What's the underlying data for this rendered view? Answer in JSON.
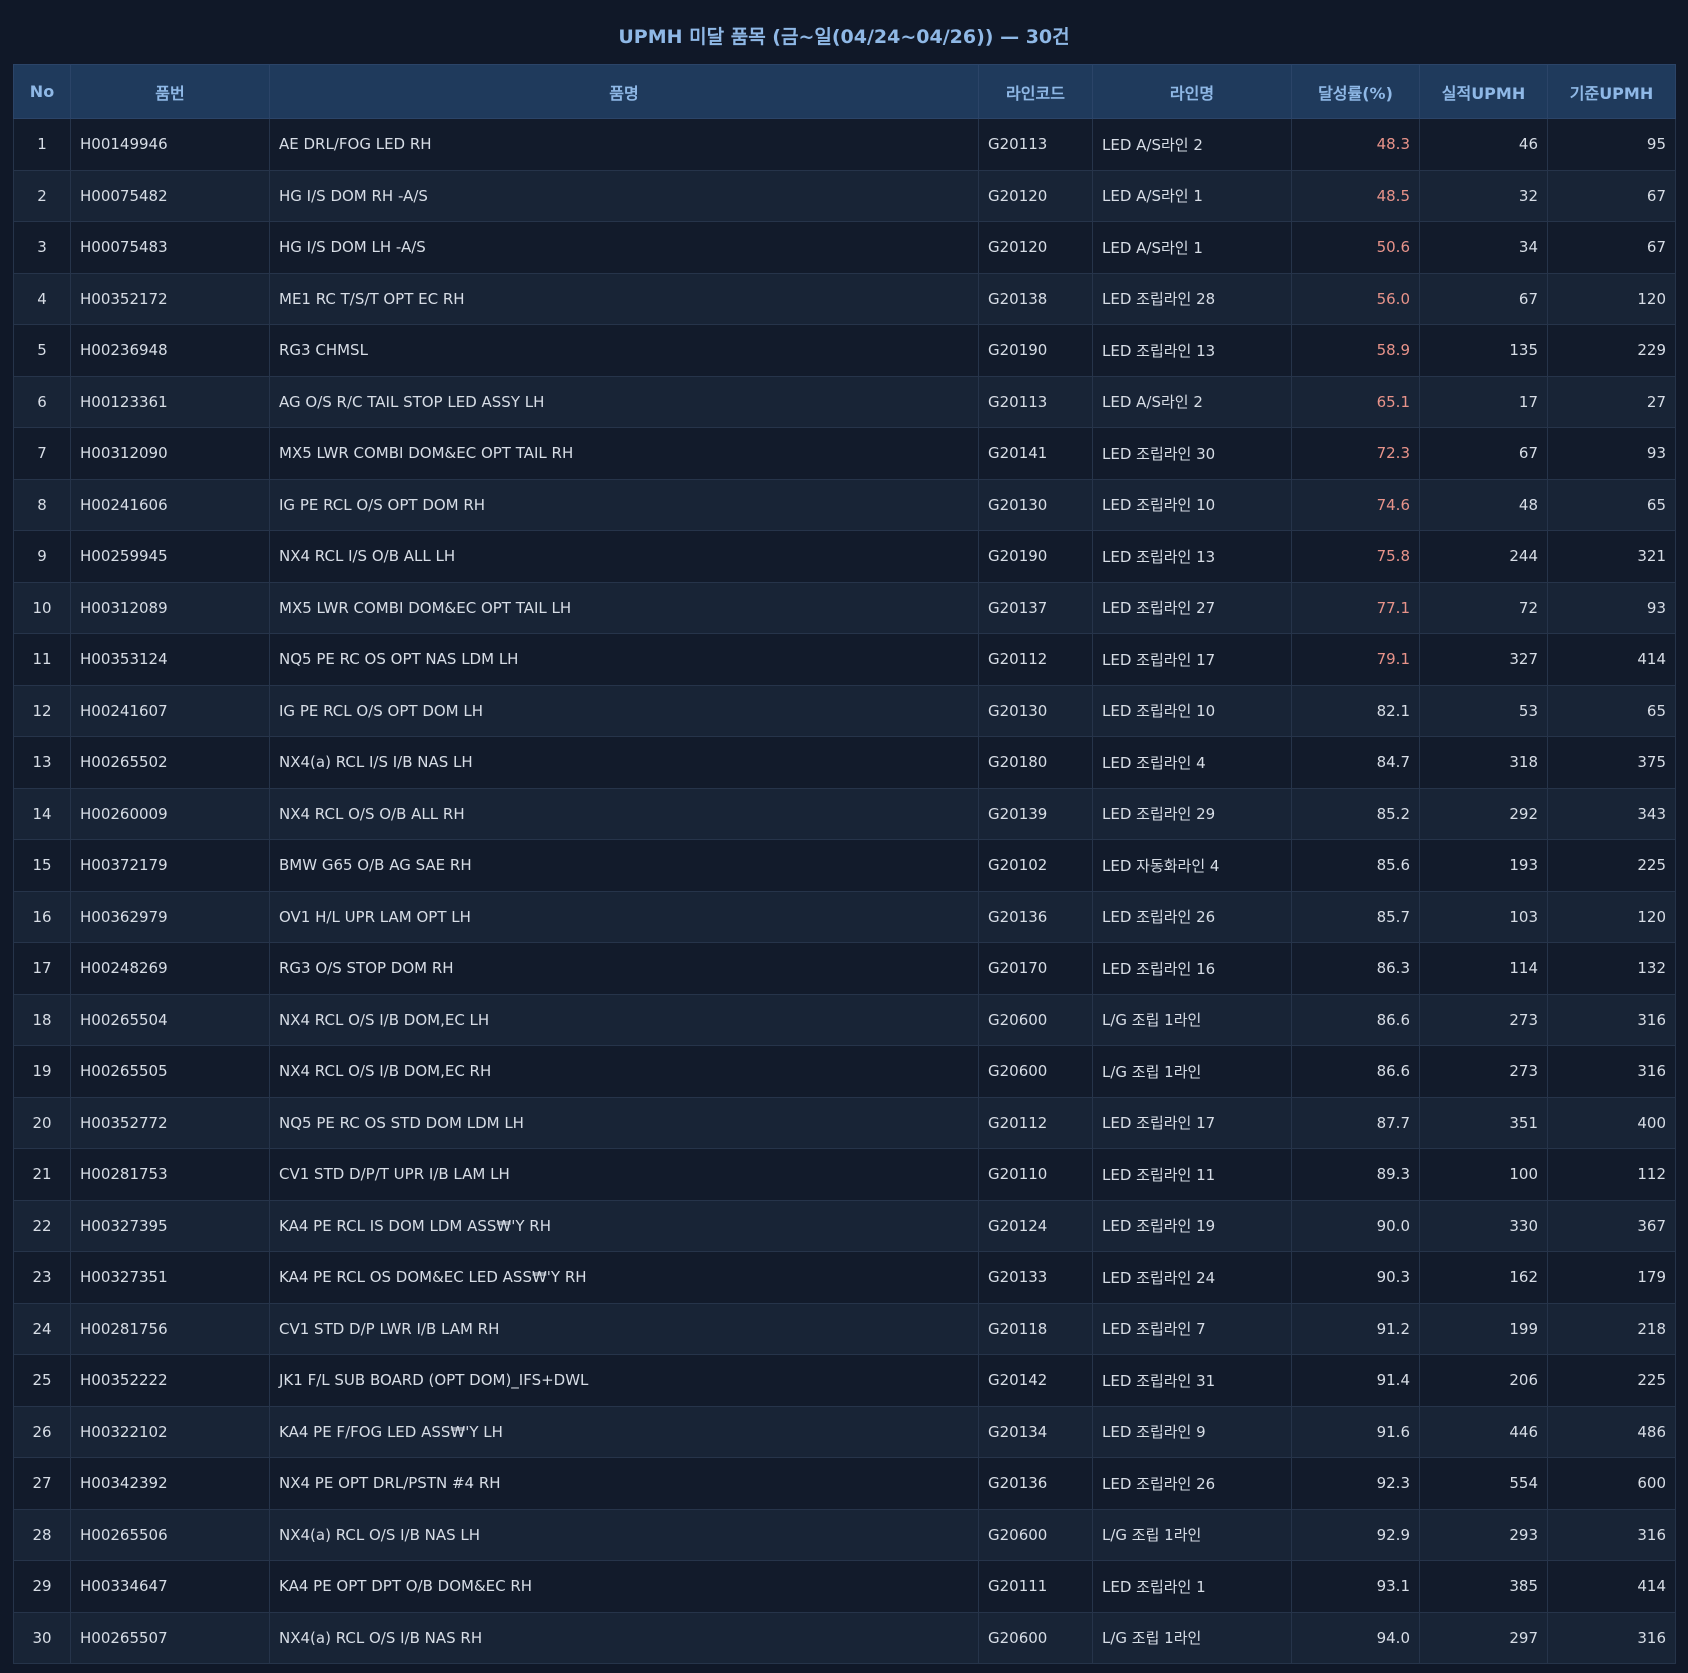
{
  "title": "UPMH 미달 품목 (금~일(04/24~04/26)) — 30건",
  "colors": {
    "background": "#101828",
    "header_bg": "#1f3a5c",
    "header_text": "#8fb8e6",
    "low_rate": "#e8938a",
    "text": "#d7dde6"
  },
  "columns": [
    "No",
    "품번",
    "품명",
    "라인코드",
    "라인명",
    "달성률(%)",
    "실적UPMH",
    "기준UPMH"
  ],
  "rows": [
    {
      "no": "1",
      "part": "H00149946",
      "name": "AE DRL/FOG LED RH",
      "code": "G20113",
      "line": "LED A/S라인 2",
      "rate": "48.3",
      "actual": "46",
      "std": "95",
      "low": true
    },
    {
      "no": "2",
      "part": "H00075482",
      "name": "HG I/S DOM RH -A/S",
      "code": "G20120",
      "line": "LED A/S라인 1",
      "rate": "48.5",
      "actual": "32",
      "std": "67",
      "low": true
    },
    {
      "no": "3",
      "part": "H00075483",
      "name": "HG I/S DOM LH -A/S",
      "code": "G20120",
      "line": "LED A/S라인 1",
      "rate": "50.6",
      "actual": "34",
      "std": "67",
      "low": true
    },
    {
      "no": "4",
      "part": "H00352172",
      "name": "ME1 RC T/S/T OPT EC RH",
      "code": "G20138",
      "line": "LED 조립라인 28",
      "rate": "56.0",
      "actual": "67",
      "std": "120",
      "low": true
    },
    {
      "no": "5",
      "part": "H00236948",
      "name": "RG3 CHMSL",
      "code": "G20190",
      "line": "LED 조립라인 13",
      "rate": "58.9",
      "actual": "135",
      "std": "229",
      "low": true
    },
    {
      "no": "6",
      "part": "H00123361",
      "name": "AG O/S R/C TAIL STOP LED ASSY LH",
      "code": "G20113",
      "line": "LED A/S라인 2",
      "rate": "65.1",
      "actual": "17",
      "std": "27",
      "low": true
    },
    {
      "no": "7",
      "part": "H00312090",
      "name": "MX5 LWR COMBI DOM&EC OPT TAIL RH",
      "code": "G20141",
      "line": "LED 조립라인 30",
      "rate": "72.3",
      "actual": "67",
      "std": "93",
      "low": true
    },
    {
      "no": "8",
      "part": "H00241606",
      "name": "IG PE RCL O/S OPT DOM RH",
      "code": "G20130",
      "line": "LED 조립라인 10",
      "rate": "74.6",
      "actual": "48",
      "std": "65",
      "low": true
    },
    {
      "no": "9",
      "part": "H00259945",
      "name": "NX4 RCL I/S O/B ALL LH",
      "code": "G20190",
      "line": "LED 조립라인 13",
      "rate": "75.8",
      "actual": "244",
      "std": "321",
      "low": true
    },
    {
      "no": "10",
      "part": "H00312089",
      "name": "MX5 LWR COMBI DOM&EC OPT TAIL LH",
      "code": "G20137",
      "line": "LED 조립라인 27",
      "rate": "77.1",
      "actual": "72",
      "std": "93",
      "low": true
    },
    {
      "no": "11",
      "part": "H00353124",
      "name": "NQ5 PE RC OS OPT NAS LDM LH",
      "code": "G20112",
      "line": "LED 조립라인 17",
      "rate": "79.1",
      "actual": "327",
      "std": "414",
      "low": true
    },
    {
      "no": "12",
      "part": "H00241607",
      "name": "IG PE RCL O/S OPT DOM LH",
      "code": "G20130",
      "line": "LED 조립라인 10",
      "rate": "82.1",
      "actual": "53",
      "std": "65",
      "low": false
    },
    {
      "no": "13",
      "part": "H00265502",
      "name": "NX4(a) RCL I/S I/B NAS LH",
      "code": "G20180",
      "line": "LED 조립라인 4",
      "rate": "84.7",
      "actual": "318",
      "std": "375",
      "low": false
    },
    {
      "no": "14",
      "part": "H00260009",
      "name": "NX4 RCL O/S O/B ALL RH",
      "code": "G20139",
      "line": "LED 조립라인 29",
      "rate": "85.2",
      "actual": "292",
      "std": "343",
      "low": false
    },
    {
      "no": "15",
      "part": "H00372179",
      "name": "BMW G65 O/B AG SAE RH",
      "code": "G20102",
      "line": "LED 자동화라인 4",
      "rate": "85.6",
      "actual": "193",
      "std": "225",
      "low": false
    },
    {
      "no": "16",
      "part": "H00362979",
      "name": "OV1 H/L UPR LAM OPT LH",
      "code": "G20136",
      "line": "LED 조립라인 26",
      "rate": "85.7",
      "actual": "103",
      "std": "120",
      "low": false
    },
    {
      "no": "17",
      "part": "H00248269",
      "name": "RG3 O/S STOP DOM RH",
      "code": "G20170",
      "line": "LED 조립라인 16",
      "rate": "86.3",
      "actual": "114",
      "std": "132",
      "low": false
    },
    {
      "no": "18",
      "part": "H00265504",
      "name": "NX4 RCL O/S I/B DOM,EC LH",
      "code": "G20600",
      "line": "L/G 조립 1라인",
      "rate": "86.6",
      "actual": "273",
      "std": "316",
      "low": false
    },
    {
      "no": "19",
      "part": "H00265505",
      "name": "NX4 RCL O/S I/B DOM,EC RH",
      "code": "G20600",
      "line": "L/G 조립 1라인",
      "rate": "86.6",
      "actual": "273",
      "std": "316",
      "low": false
    },
    {
      "no": "20",
      "part": "H00352772",
      "name": "NQ5 PE RC OS STD DOM LDM LH",
      "code": "G20112",
      "line": "LED 조립라인 17",
      "rate": "87.7",
      "actual": "351",
      "std": "400",
      "low": false
    },
    {
      "no": "21",
      "part": "H00281753",
      "name": "CV1 STD D/P/T UPR I/B LAM LH",
      "code": "G20110",
      "line": "LED 조립라인 11",
      "rate": "89.3",
      "actual": "100",
      "std": "112",
      "low": false
    },
    {
      "no": "22",
      "part": "H00327395",
      "name": "KA4 PE RCL IS DOM LDM ASS₩'Y RH",
      "code": "G20124",
      "line": "LED 조립라인 19",
      "rate": "90.0",
      "actual": "330",
      "std": "367",
      "low": false
    },
    {
      "no": "23",
      "part": "H00327351",
      "name": "KA4 PE RCL OS DOM&EC LED ASS₩'Y RH",
      "code": "G20133",
      "line": "LED 조립라인 24",
      "rate": "90.3",
      "actual": "162",
      "std": "179",
      "low": false
    },
    {
      "no": "24",
      "part": "H00281756",
      "name": "CV1 STD D/P LWR I/B LAM RH",
      "code": "G20118",
      "line": "LED 조립라인 7",
      "rate": "91.2",
      "actual": "199",
      "std": "218",
      "low": false
    },
    {
      "no": "25",
      "part": "H00352222",
      "name": "JK1 F/L SUB BOARD (OPT DOM)_IFS+DWL",
      "code": "G20142",
      "line": "LED 조립라인 31",
      "rate": "91.4",
      "actual": "206",
      "std": "225",
      "low": false
    },
    {
      "no": "26",
      "part": "H00322102",
      "name": "KA4 PE F/FOG LED ASS₩'Y LH",
      "code": "G20134",
      "line": "LED 조립라인 9",
      "rate": "91.6",
      "actual": "446",
      "std": "486",
      "low": false
    },
    {
      "no": "27",
      "part": "H00342392",
      "name": "NX4 PE OPT DRL/PSTN #4 RH",
      "code": "G20136",
      "line": "LED 조립라인 26",
      "rate": "92.3",
      "actual": "554",
      "std": "600",
      "low": false
    },
    {
      "no": "28",
      "part": "H00265506",
      "name": "NX4(a) RCL O/S I/B NAS LH",
      "code": "G20600",
      "line": "L/G 조립 1라인",
      "rate": "92.9",
      "actual": "293",
      "std": "316",
      "low": false
    },
    {
      "no": "29",
      "part": "H00334647",
      "name": "KA4 PE OPT DPT O/B DOM&EC RH",
      "code": "G20111",
      "line": "LED 조립라인 1",
      "rate": "93.1",
      "actual": "385",
      "std": "414",
      "low": false
    },
    {
      "no": "30",
      "part": "H00265507",
      "name": "NX4(a) RCL O/S I/B NAS RH",
      "code": "G20600",
      "line": "L/G 조립 1라인",
      "rate": "94.0",
      "actual": "297",
      "std": "316",
      "low": false
    }
  ]
}
